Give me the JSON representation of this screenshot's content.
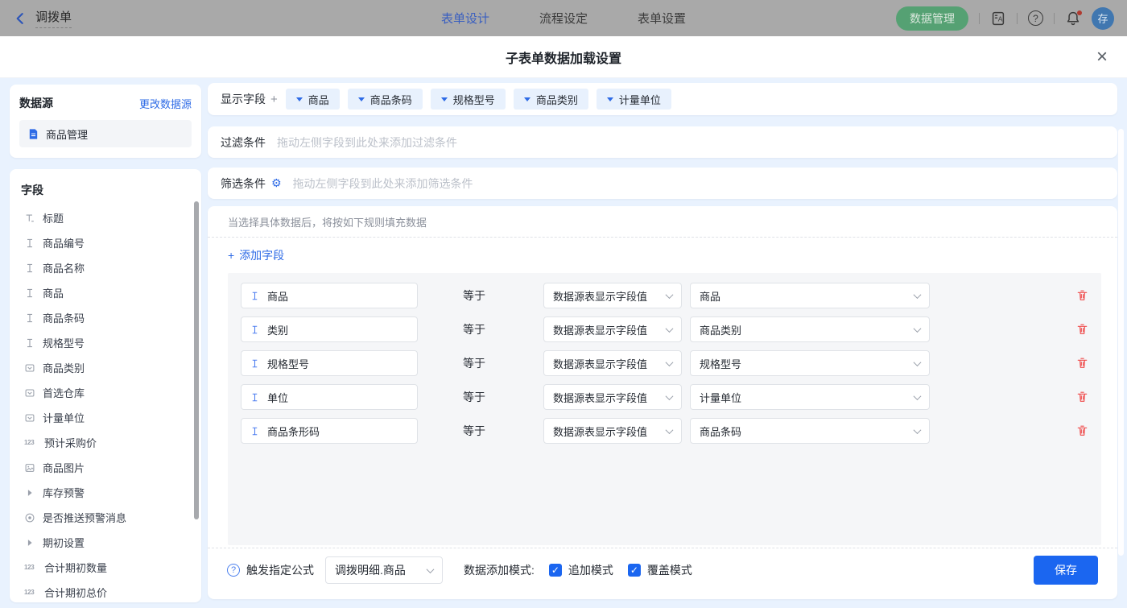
{
  "topbar": {
    "back_label": "调拨单",
    "tabs": [
      {
        "label": "表单设计",
        "active": true
      },
      {
        "label": "流程设定",
        "active": false
      },
      {
        "label": "表单设置",
        "active": false
      }
    ],
    "data_manage_label": "数据管理",
    "avatar_text": "存"
  },
  "modal": {
    "title": "子表单数据加载设置"
  },
  "sidebar": {
    "datasource": {
      "title": "数据源",
      "change_link": "更改数据源",
      "item": "商品管理",
      "item_icon": "document-icon"
    },
    "fields": {
      "title": "字段",
      "items": [
        {
          "icon": "title-icon",
          "label": "标题"
        },
        {
          "icon": "text-icon",
          "label": "商品编号"
        },
        {
          "icon": "text-icon",
          "label": "商品名称"
        },
        {
          "icon": "text-icon",
          "label": "商品"
        },
        {
          "icon": "text-icon",
          "label": "商品条码"
        },
        {
          "icon": "text-icon",
          "label": "规格型号"
        },
        {
          "icon": "select-icon",
          "label": "商品类别"
        },
        {
          "icon": "select-icon",
          "label": "首选仓库"
        },
        {
          "icon": "select-icon",
          "label": "计量单位"
        },
        {
          "icon": "number-icon",
          "label": "预计采购价"
        },
        {
          "icon": "image-icon",
          "label": "商品图片"
        },
        {
          "icon": "caret-right-icon",
          "label": "库存预警"
        },
        {
          "icon": "radio-icon",
          "label": "是否推送预警消息"
        },
        {
          "icon": "caret-right-icon",
          "label": "期初设置"
        },
        {
          "icon": "number-icon",
          "label": "合计期初数量"
        },
        {
          "icon": "number-icon",
          "label": "合计期初总价"
        }
      ]
    }
  },
  "main": {
    "display_fields": {
      "label": "显示字段",
      "tags": [
        "商品",
        "商品条码",
        "规格型号",
        "商品类别",
        "计量单位"
      ]
    },
    "filter": {
      "label": "过滤条件",
      "placeholder": "拖动左侧字段到此处来添加过滤条件"
    },
    "screen": {
      "label": "筛选条件",
      "placeholder": "拖动左侧字段到此处来添加筛选条件"
    },
    "rules": {
      "header": "当选择具体数据后，将按如下规则填充数据",
      "add_field": "添加字段",
      "operator": "等于",
      "rows": [
        {
          "field": "商品",
          "source": "数据源表显示字段值",
          "value": "商品"
        },
        {
          "field": "类别",
          "source": "数据源表显示字段值",
          "value": "商品类别"
        },
        {
          "field": "规格型号",
          "source": "数据源表显示字段值",
          "value": "规格型号"
        },
        {
          "field": "单位",
          "source": "数据源表显示字段值",
          "value": "计量单位"
        },
        {
          "field": "商品条形码",
          "source": "数据源表显示字段值",
          "value": "商品条码"
        }
      ]
    },
    "footer": {
      "formula_label": "触发指定公式",
      "formula_value": "调拨明细.商品",
      "mode_label": "数据添加模式:",
      "modes": [
        {
          "label": "追加模式",
          "checked": true
        },
        {
          "label": "覆盖模式",
          "checked": true
        }
      ],
      "save_label": "保存"
    }
  },
  "icons": {
    "plus": "+",
    "gear": "⚙",
    "check": "✓",
    "close": "×",
    "help": "?",
    "number": "123",
    "booklet_letter": "A"
  },
  "colors": {
    "primary_blue": "#1b66f0",
    "link_blue": "#2e6be6",
    "tag_bg": "#e8f1fd",
    "green_badge": "#54a173",
    "danger_red": "#ef4a4a",
    "modal_bg": "#e9f2fe",
    "panel_gray": "#f5f6f8"
  }
}
